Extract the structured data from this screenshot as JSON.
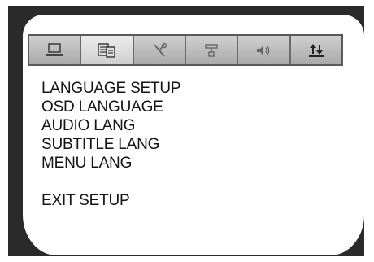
{
  "tabs": [
    {
      "id": "general",
      "icon": "monitor-icon",
      "active": false
    },
    {
      "id": "language",
      "icon": "language-setup-icon",
      "active": true
    },
    {
      "id": "video",
      "icon": "tools-icon",
      "active": false
    },
    {
      "id": "preference",
      "icon": "connection-icon",
      "active": false
    },
    {
      "id": "audio",
      "icon": "speaker-icon",
      "active": false
    },
    {
      "id": "digital",
      "icon": "up-down-arrows-icon",
      "active": false
    }
  ],
  "menu": {
    "title": "LANGUAGE SETUP",
    "items": [
      {
        "label": "OSD LANGUAGE"
      },
      {
        "label": "AUDIO LANG"
      },
      {
        "label": "SUBTITLE LANG"
      },
      {
        "label": "MENU LANG"
      }
    ],
    "exit_label": "EXIT SETUP"
  }
}
